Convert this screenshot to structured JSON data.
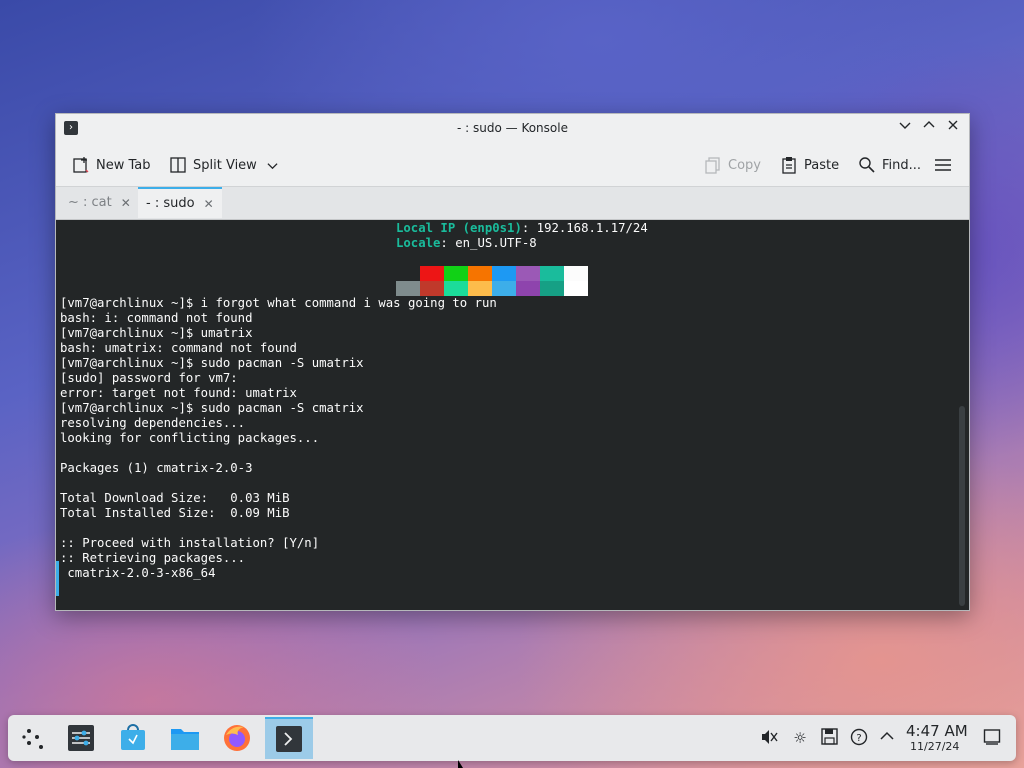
{
  "window": {
    "title": "- : sudo — Konsole",
    "icon": "terminal-icon"
  },
  "toolbar": {
    "new_tab": "New Tab",
    "split_view": "Split View",
    "copy": "Copy",
    "paste": "Paste",
    "find": "Find..."
  },
  "tabs": [
    {
      "label": "~ : cat",
      "active": false
    },
    {
      "label": "- : sudo",
      "active": true
    }
  ],
  "terminal": {
    "info": [
      {
        "key": "Local IP (enp0s1)",
        "value": ": 192.168.1.17/24"
      },
      {
        "key": "Locale",
        "value": ": en_US.UTF-8"
      }
    ],
    "palette_row1": [
      "#232627",
      "#ed1515",
      "#11d116",
      "#f67400",
      "#1d99f3",
      "#9b59b6",
      "#1abc9c",
      "#fcfcfc"
    ],
    "palette_row2": [
      "#7f8c8d",
      "#c0392b",
      "#1cdc9a",
      "#fdbc4b",
      "#3daee9",
      "#8e44ad",
      "#16a085",
      "#ffffff"
    ],
    "lines": [
      "[vm7@archlinux ~]$ i forgot what command i was going to run",
      "bash: i: command not found",
      "[vm7@archlinux ~]$ umatrix",
      "bash: umatrix: command not found",
      "[vm7@archlinux ~]$ sudo pacman -S umatrix",
      "[sudo] password for vm7:",
      "error: target not found: umatrix",
      "[vm7@archlinux ~]$ sudo pacman -S cmatrix",
      "resolving dependencies...",
      "looking for conflicting packages...",
      "",
      "Packages (1) cmatrix-2.0-3",
      "",
      "Total Download Size:   0.03 MiB",
      "Total Installed Size:  0.09 MiB",
      "",
      ":: Proceed with installation? [Y/n]",
      ":: Retrieving packages...",
      " cmatrix-2.0-3-x86_64"
    ]
  },
  "taskbar": {
    "apps": [
      "app-launcher-icon",
      "system-settings-icon",
      "discover-store-icon",
      "file-manager-icon",
      "firefox-icon",
      "konsole-icon"
    ],
    "tray": [
      "volume-muted-icon",
      "brightness-icon",
      "save-icon",
      "help-icon",
      "chevron-up-icon"
    ],
    "time": "4:47 AM",
    "date": "11/27/24"
  }
}
